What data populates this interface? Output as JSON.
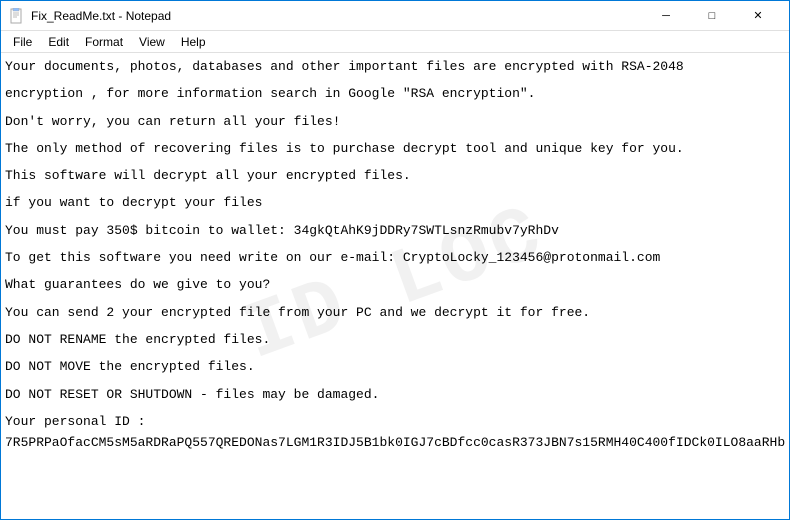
{
  "window": {
    "title": "Fix_ReadMe.txt - Notepad",
    "title_icon": "📄"
  },
  "title_controls": {
    "minimize": "─",
    "maximize": "□",
    "close": "✕"
  },
  "menu": {
    "items": [
      "File",
      "Edit",
      "Format",
      "View",
      "Help"
    ]
  },
  "watermark": {
    "text": "ID LOC"
  },
  "content": {
    "lines": [
      "Your documents, photos, databases and other important files are encrypted with RSA-2048",
      "",
      "encryption , for more information search in Google \"RSA encryption\".",
      "",
      "Don't worry, you can return all your files!",
      "",
      "The only method of recovering files is to purchase decrypt tool and unique key for you.",
      "",
      "This software will decrypt all your encrypted files.",
      "",
      "if you want to decrypt your files",
      "",
      "You must pay 350$ bitcoin to wallet: 34gkQtAhK9jDDRy7SWTLsnzRmubv7yRhDv",
      "",
      "To get this software you need write on our e-mail: CryptoLocky_123456@protonmail.com",
      "",
      "What guarantees do we give to you?",
      "",
      "You can send 2 your encrypted file from your PC and we decrypt it for free.",
      "",
      "DO NOT RENAME the encrypted files.",
      "",
      "DO NOT MOVE the encrypted files.",
      "",
      "DO NOT RESET OR SHUTDOWN - files may be damaged.",
      "",
      "Your personal ID :",
      "7R5PRPaOfacCM5sM5aRDRaPQ557QREDONas7LGM1R3IDJ5B1bk0IGJ7cBDfcc0casR373JBN7s15RMH40C400fIDCk0ILO8aaRHb"
    ]
  }
}
